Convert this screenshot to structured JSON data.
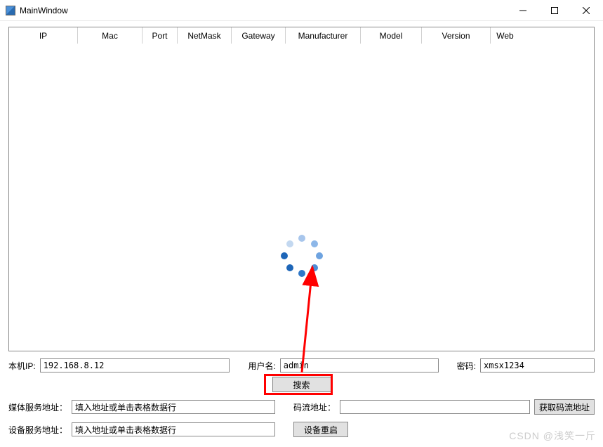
{
  "window": {
    "title": "MainWindow"
  },
  "table": {
    "columns": [
      {
        "label": "IP",
        "width": 98
      },
      {
        "label": "Mac",
        "width": 92
      },
      {
        "label": "Port",
        "width": 50
      },
      {
        "label": "NetMask",
        "width": 77
      },
      {
        "label": "Gateway",
        "width": 77
      },
      {
        "label": "Manufacturer",
        "width": 107
      },
      {
        "label": "Model",
        "width": 87
      },
      {
        "label": "Version",
        "width": 98
      },
      {
        "label": "Web",
        "width": 41
      }
    ]
  },
  "credentials": {
    "local_ip_label": "本机IP:",
    "local_ip_value": "192.168.8.12",
    "username_label": "用户名:",
    "username_value": "admin",
    "password_label": "密码:",
    "password_value": "xmsx1234"
  },
  "buttons": {
    "search": "搜索",
    "get_stream_url": "获取码流地址",
    "device_restart": "设备重启"
  },
  "addresses": {
    "media_service_label": "媒体服务地址：",
    "media_service_placeholder": "填入地址或单击表格数据行",
    "stream_label": "码流地址：",
    "device_service_label": "设备服务地址：",
    "device_service_placeholder": "填入地址或单击表格数据行"
  },
  "watermark": "CSDN @浅笑一斤",
  "spinner": {
    "colors": [
      "#8db7e8",
      "#6ea3e0",
      "#4d8dd6",
      "#3078c8",
      "#1e66b8",
      "#1e66b8",
      "#3078c8",
      "#a8c6ec"
    ]
  }
}
